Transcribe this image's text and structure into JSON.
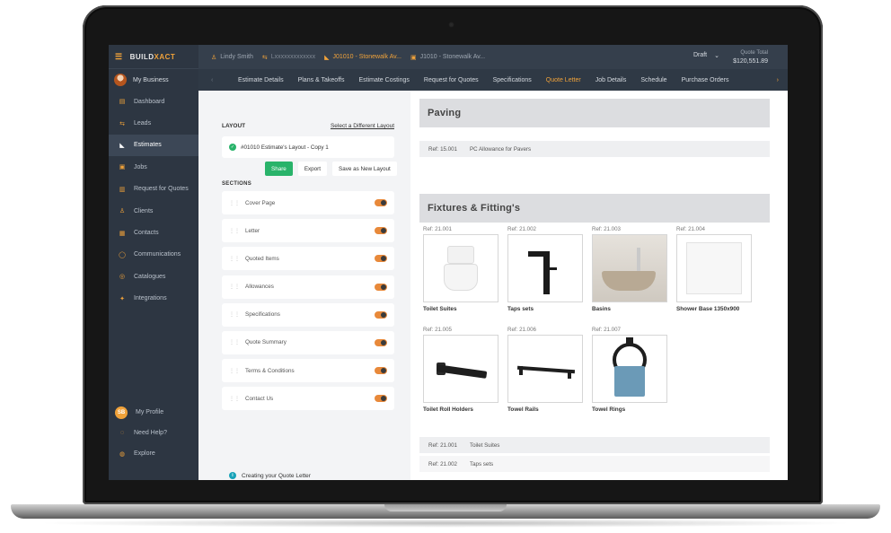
{
  "app": {
    "brand_prefix": "BUILD",
    "brand_suffix": "XACT",
    "business_label": "My Business"
  },
  "sidebar": {
    "items": [
      {
        "label": "Dashboard",
        "icon": "chart-icon"
      },
      {
        "label": "Leads",
        "icon": "leads-icon"
      },
      {
        "label": "Estimates",
        "icon": "estimates-icon",
        "active": true
      },
      {
        "label": "Jobs",
        "icon": "jobs-icon"
      },
      {
        "label": "Request for Quotes",
        "icon": "rfq-icon"
      },
      {
        "label": "Clients",
        "icon": "clients-icon"
      },
      {
        "label": "Contacts",
        "icon": "contacts-icon"
      },
      {
        "label": "Communications",
        "icon": "chat-icon"
      },
      {
        "label": "Catalogues",
        "icon": "catalogue-icon"
      },
      {
        "label": "Integrations",
        "icon": "integrations-icon"
      }
    ],
    "bottom": {
      "profile_initials": "SB",
      "profile_label": "My Profile",
      "help_label": "Need Help?",
      "explore_label": "Explore"
    }
  },
  "topbar": {
    "user": "Lindy Smith",
    "contact": "Lxxxxxxxxxxxxx",
    "job_highlight": "J01010 - Stonewalk Av...",
    "job": "J1010 - Stonewalk Av...",
    "status": "Draft",
    "quote_total_label": "Quote Total",
    "quote_total_value": "$120,551.89"
  },
  "tabs": [
    {
      "label": "Estimate Details"
    },
    {
      "label": "Plans & Takeoffs"
    },
    {
      "label": "Estimate Costings"
    },
    {
      "label": "Request for Quotes"
    },
    {
      "label": "Specifications"
    },
    {
      "label": "Quote Letter",
      "active": true
    },
    {
      "label": "Job Details"
    },
    {
      "label": "Schedule"
    },
    {
      "label": "Purchase Orders"
    }
  ],
  "layout_panel": {
    "heading": "LAYOUT",
    "select_link": "Select a Different Layout",
    "current_layout": "#01010 Estimate's Layout - Copy 1",
    "buttons": {
      "share": "Share",
      "export": "Export",
      "save_new": "Save as New Layout"
    },
    "sections_heading": "SECTIONS",
    "sections": [
      {
        "label": "Cover Page",
        "enabled": true
      },
      {
        "label": "Letter",
        "enabled": true
      },
      {
        "label": "Quoted Items",
        "enabled": true
      },
      {
        "label": "Allowances",
        "enabled": true
      },
      {
        "label": "Specifications",
        "enabled": true
      },
      {
        "label": "Quote Summary",
        "enabled": true
      },
      {
        "label": "Terms & Conditions",
        "enabled": true
      },
      {
        "label": "Contact Us",
        "enabled": true
      }
    ],
    "info_text": "Creating your Quote Letter"
  },
  "preview": {
    "paving": {
      "title": "Paving",
      "ref": "Ref: 15.001",
      "desc": "PC Allowance for Pavers"
    },
    "fixtures": {
      "title": "Fixtures & Fitting's",
      "products": [
        {
          "ref": "Ref: 21.001",
          "name": "Toilet Suites"
        },
        {
          "ref": "Ref: 21.002",
          "name": "Taps sets"
        },
        {
          "ref": "Ref: 21.003",
          "name": "Basins"
        },
        {
          "ref": "Ref: 21.004",
          "name": "Shower Base 1350x900"
        },
        {
          "ref": "Ref: 21.005",
          "name": "Toilet Roll Holders"
        },
        {
          "ref": "Ref: 21.006",
          "name": "Towel Rails"
        },
        {
          "ref": "Ref: 21.007",
          "name": "Towel Rings"
        }
      ]
    },
    "summary_rows": [
      {
        "ref": "Ref: 21.001",
        "desc": "Toilet Suites"
      },
      {
        "ref": "Ref: 21.002",
        "desc": "Taps sets"
      }
    ]
  }
}
